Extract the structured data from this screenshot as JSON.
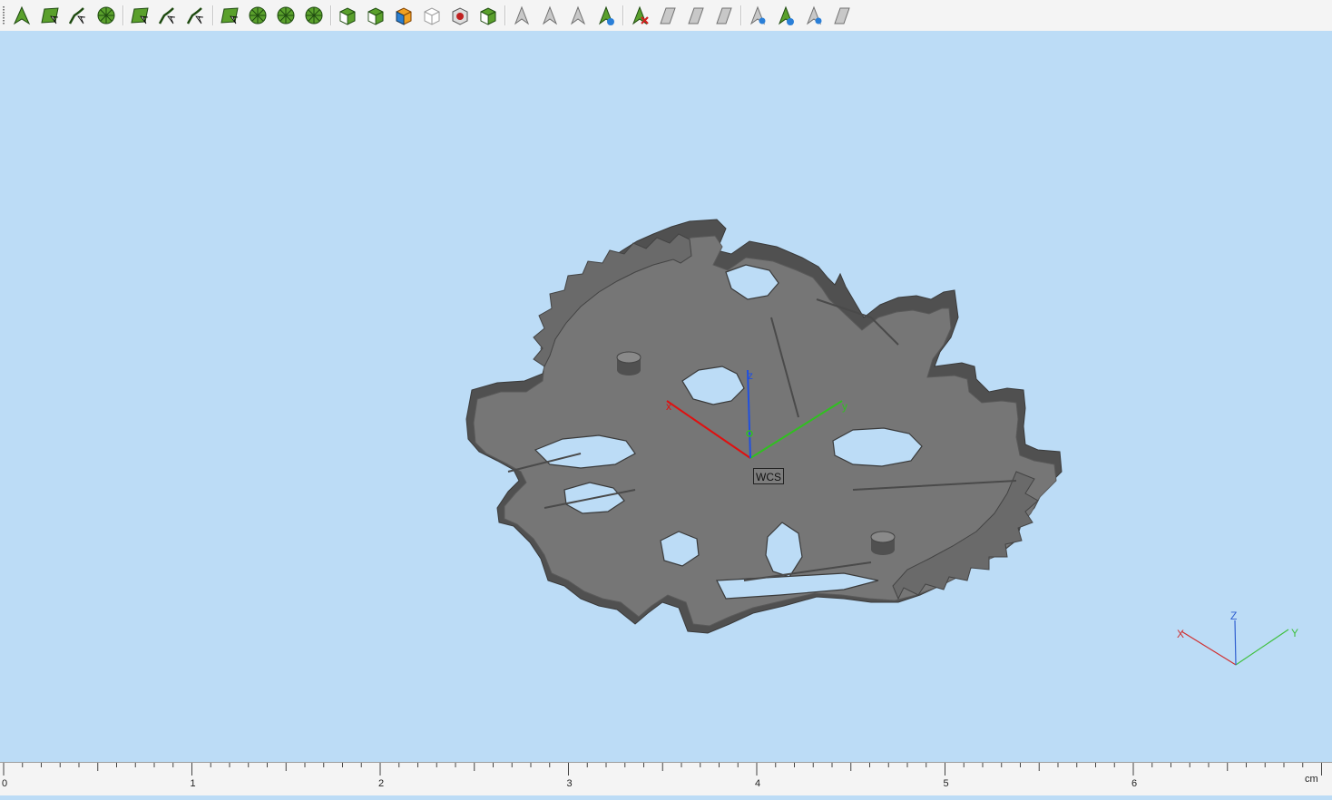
{
  "toolbar": {
    "groups": [
      [
        "select-vertex",
        "select-edge",
        "select-wire",
        "select-face-by-vertex"
      ],
      [
        "select-face",
        "select-shell-by-face",
        "select-sweep-curve"
      ],
      [
        "select-shell",
        "select-solid",
        "select-compound",
        "select-wheel"
      ],
      [
        "box-view-1",
        "box-view-2",
        "box-view-colored",
        "box-view-outline",
        "box-view-red",
        "box-view-green"
      ],
      [
        "arrow-tool-1",
        "arrow-tool-2",
        "arrow-tool-3",
        "arrow-tool-4"
      ],
      [
        "delete-arrow",
        "plane-tool-1",
        "plane-tool-2",
        "plane-tool-3"
      ],
      [
        "measure-1",
        "measure-2",
        "measure-3",
        "measure-4"
      ]
    ]
  },
  "viewport": {
    "background": "#bcdcf6",
    "wcs": {
      "label": "WCS",
      "x_label": "x",
      "y_label": "y",
      "z_label": "z"
    },
    "triad": {
      "x_label": "X",
      "y_label": "Y",
      "z_label": "Z"
    },
    "colors": {
      "x_axis": "#e01010",
      "y_axis": "#30c020",
      "z_axis": "#2050e0",
      "model": "#767676"
    }
  },
  "ruler": {
    "ticks": [
      "0",
      "1",
      "2",
      "3",
      "4",
      "5",
      "6"
    ],
    "unit": "cm"
  }
}
